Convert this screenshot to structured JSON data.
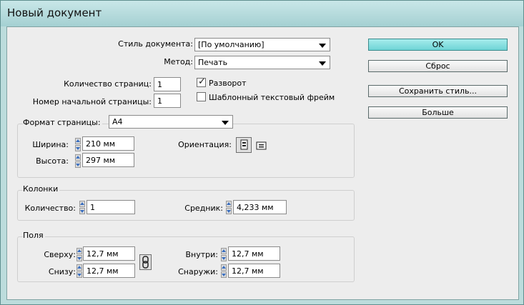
{
  "window": {
    "title": "Новый документ"
  },
  "document": {
    "style_label": "Стиль документа:",
    "style_value": "[По умолчанию]",
    "method_label": "Метод:",
    "method_value": "Печать",
    "pages_label": "Количество страниц:",
    "pages_value": "1",
    "start_page_label": "Номер начальной страницы:",
    "start_page_value": "1",
    "facing_label": "Разворот",
    "facing_checked": true,
    "master_frame_label": "Шаблонный текстовый фрейм",
    "master_frame_checked": false
  },
  "page_size": {
    "label": "Формат страницы:",
    "value": "A4",
    "width_label": "Ширина:",
    "width_value": "210 мм",
    "height_label": "Высота:",
    "height_value": "297 мм",
    "orientation_label": "Ориентация:"
  },
  "columns": {
    "section_title": "Колонки",
    "count_label": "Количество:",
    "count_value": "1",
    "gutter_label": "Средник:",
    "gutter_value": "4,233 мм"
  },
  "margins": {
    "section_title": "Поля",
    "top_label": "Сверху:",
    "top_value": "12,7 мм",
    "bottom_label": "Снизу:",
    "bottom_value": "12,7 мм",
    "inside_label": "Внутри:",
    "inside_value": "12,7 мм",
    "outside_label": "Снаружи:",
    "outside_value": "12,7 мм"
  },
  "buttons": {
    "ok": "OK",
    "reset": "Сброс",
    "save_style": "Сохранить стиль...",
    "more": "Больше"
  },
  "colors": {
    "accent": "#6ed4d6",
    "title_bar": "#a4d0d2"
  }
}
